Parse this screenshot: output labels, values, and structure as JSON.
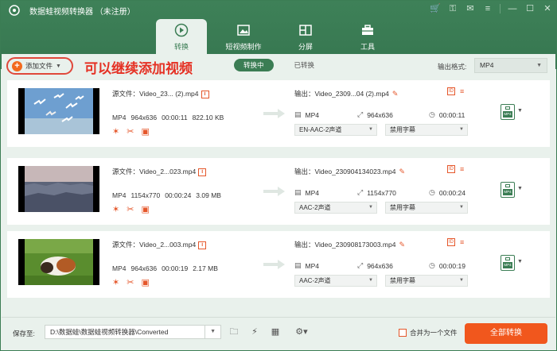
{
  "app": {
    "title": "数据蛙视频转换器 （未注册）",
    "window_controls": [
      "cart-icon",
      "key-icon",
      "chat-icon",
      "menu-icon",
      "minimize-icon",
      "maximize-icon",
      "close-icon"
    ]
  },
  "tabs": [
    {
      "label": "转换",
      "icon": "convert-icon",
      "active": true
    },
    {
      "label": "短视频制作",
      "icon": "short-video-icon",
      "active": false
    },
    {
      "label": "分屏",
      "icon": "split-screen-icon",
      "active": false
    },
    {
      "label": "工具",
      "icon": "toolbox-icon",
      "active": false
    }
  ],
  "toolbar": {
    "add_file_label": "添加文件",
    "annotation": "可以继续添加视频",
    "mode_converting": "转换中",
    "mode_converted": "已转换",
    "output_format_label": "输出格式:",
    "output_format_value": "MP4"
  },
  "files": [
    {
      "source_name": "源文件：Video_23... (2).mp4",
      "format": "MP4",
      "resolution": "964x636",
      "duration": "00:00:11",
      "size": "822.10 KB",
      "output_name": "输出：Video_2309...04 (2).mp4",
      "out_format": "MP4",
      "out_resolution": "964x636",
      "out_duration": "00:00:11",
      "audio": "EN-AAC-2声道",
      "subtitle": "禁用字幕"
    },
    {
      "source_name": "源文件：Video_2...023.mp4",
      "format": "MP4",
      "resolution": "1154x770",
      "duration": "00:00:24",
      "size": "3.09 MB",
      "output_name": "输出：Video_230904134023.mp4",
      "out_format": "MP4",
      "out_resolution": "1154x770",
      "out_duration": "00:00:24",
      "audio": "AAC-2声道",
      "subtitle": "禁用字幕"
    },
    {
      "source_name": "源文件：Video_2...003.mp4",
      "format": "MP4",
      "resolution": "964x636",
      "duration": "00:00:19",
      "size": "2.17 MB",
      "output_name": "输出：Video_230908173003.mp4",
      "out_format": "MP4",
      "out_resolution": "964x636",
      "out_duration": "00:00:19",
      "audio": "AAC-2声道",
      "subtitle": "禁用字幕"
    }
  ],
  "footer": {
    "save_to_label": "保存至:",
    "save_path": "D:\\数据蛙\\数据蛙视频转换器\\Converted",
    "merge_label": "合并为一个文件",
    "convert_all_label": "全部转换"
  },
  "colors": {
    "brand_green": "#3b7d54",
    "accent_orange": "#f1571d",
    "annotation_red": "#e53124"
  }
}
